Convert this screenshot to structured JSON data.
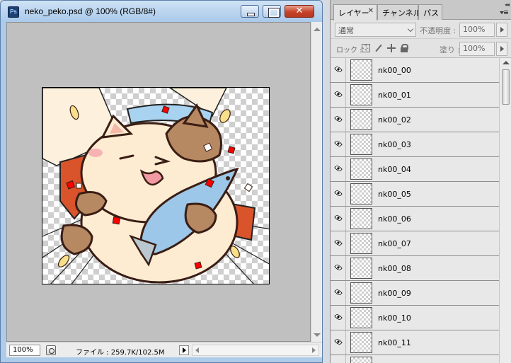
{
  "document": {
    "title": "neko_peko.psd @ 100% (RGB/8#)",
    "app_icon_label": "Ps",
    "window_buttons": {
      "close": "✕"
    },
    "zoom": "100%",
    "file_info": "ファイル : 259.7K/102.5M"
  },
  "layers_panel": {
    "tabs": {
      "layers": "レイヤー",
      "layers_close": "✕",
      "channels": "チャンネル",
      "paths": "パス"
    },
    "collapse_glyph": "◂◂",
    "blend_mode": "通常",
    "opacity_label": "不透明度 :",
    "opacity_value": "100%",
    "lock_label": "ロック :",
    "fill_label": "塗り :",
    "fill_value": "100%",
    "layers": [
      {
        "name": "nk00_00",
        "visible": true
      },
      {
        "name": "nk00_01",
        "visible": true
      },
      {
        "name": "nk00_02",
        "visible": true
      },
      {
        "name": "nk00_03",
        "visible": true
      },
      {
        "name": "nk00_04",
        "visible": true
      },
      {
        "name": "nk00_05",
        "visible": true
      },
      {
        "name": "nk00_06",
        "visible": true
      },
      {
        "name": "nk00_07",
        "visible": true
      },
      {
        "name": "nk00_08",
        "visible": true
      },
      {
        "name": "nk00_09",
        "visible": true
      },
      {
        "name": "nk00_10",
        "visible": true
      },
      {
        "name": "nk00_11",
        "visible": true
      },
      {
        "name": "",
        "visible": false
      }
    ]
  }
}
